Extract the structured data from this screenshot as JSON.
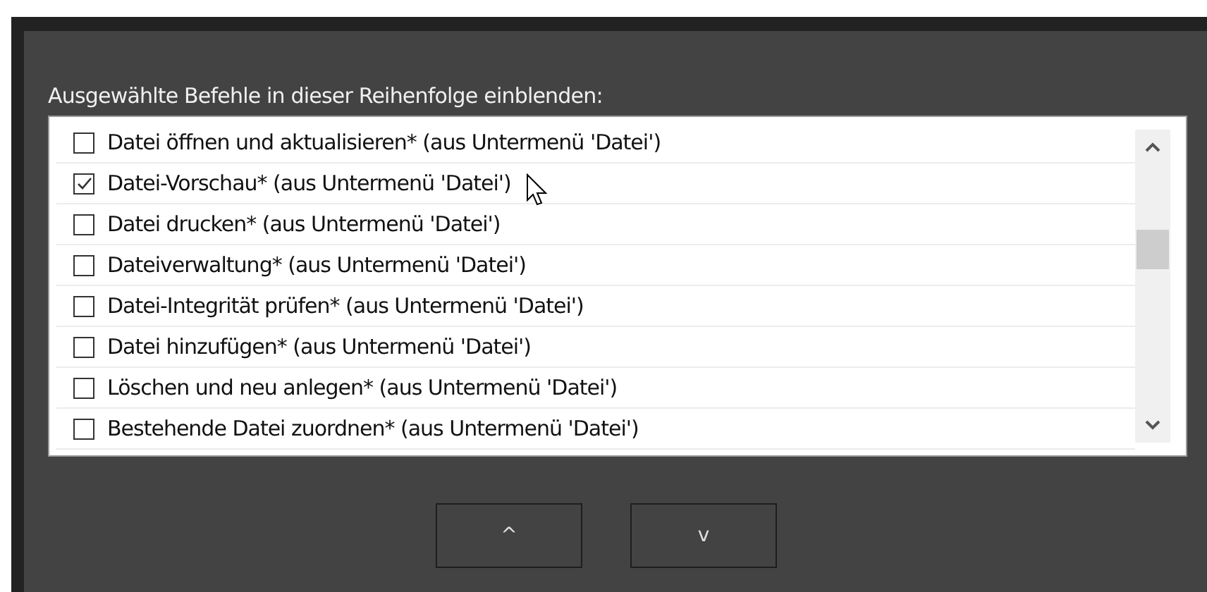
{
  "heading": "Ausgewählte Befehle in dieser Reihenfolge einblenden:",
  "items": [
    {
      "label": "Datei öffnen und aktualisieren* (aus Untermenü 'Datei')",
      "checked": false
    },
    {
      "label": "Datei-Vorschau* (aus Untermenü 'Datei')",
      "checked": true
    },
    {
      "label": "Datei drucken* (aus Untermenü 'Datei')",
      "checked": false
    },
    {
      "label": "Dateiverwaltung* (aus Untermenü 'Datei')",
      "checked": false
    },
    {
      "label": "Datei-Integrität prüfen* (aus Untermenü 'Datei')",
      "checked": false
    },
    {
      "label": "Datei hinzufügen* (aus Untermenü 'Datei')",
      "checked": false
    },
    {
      "label": "Löschen und neu anlegen* (aus Untermenü 'Datei')",
      "checked": false
    },
    {
      "label": "Bestehende Datei zuordnen* (aus Untermenü 'Datei')",
      "checked": false
    }
  ],
  "buttons": [
    "^",
    "v"
  ]
}
